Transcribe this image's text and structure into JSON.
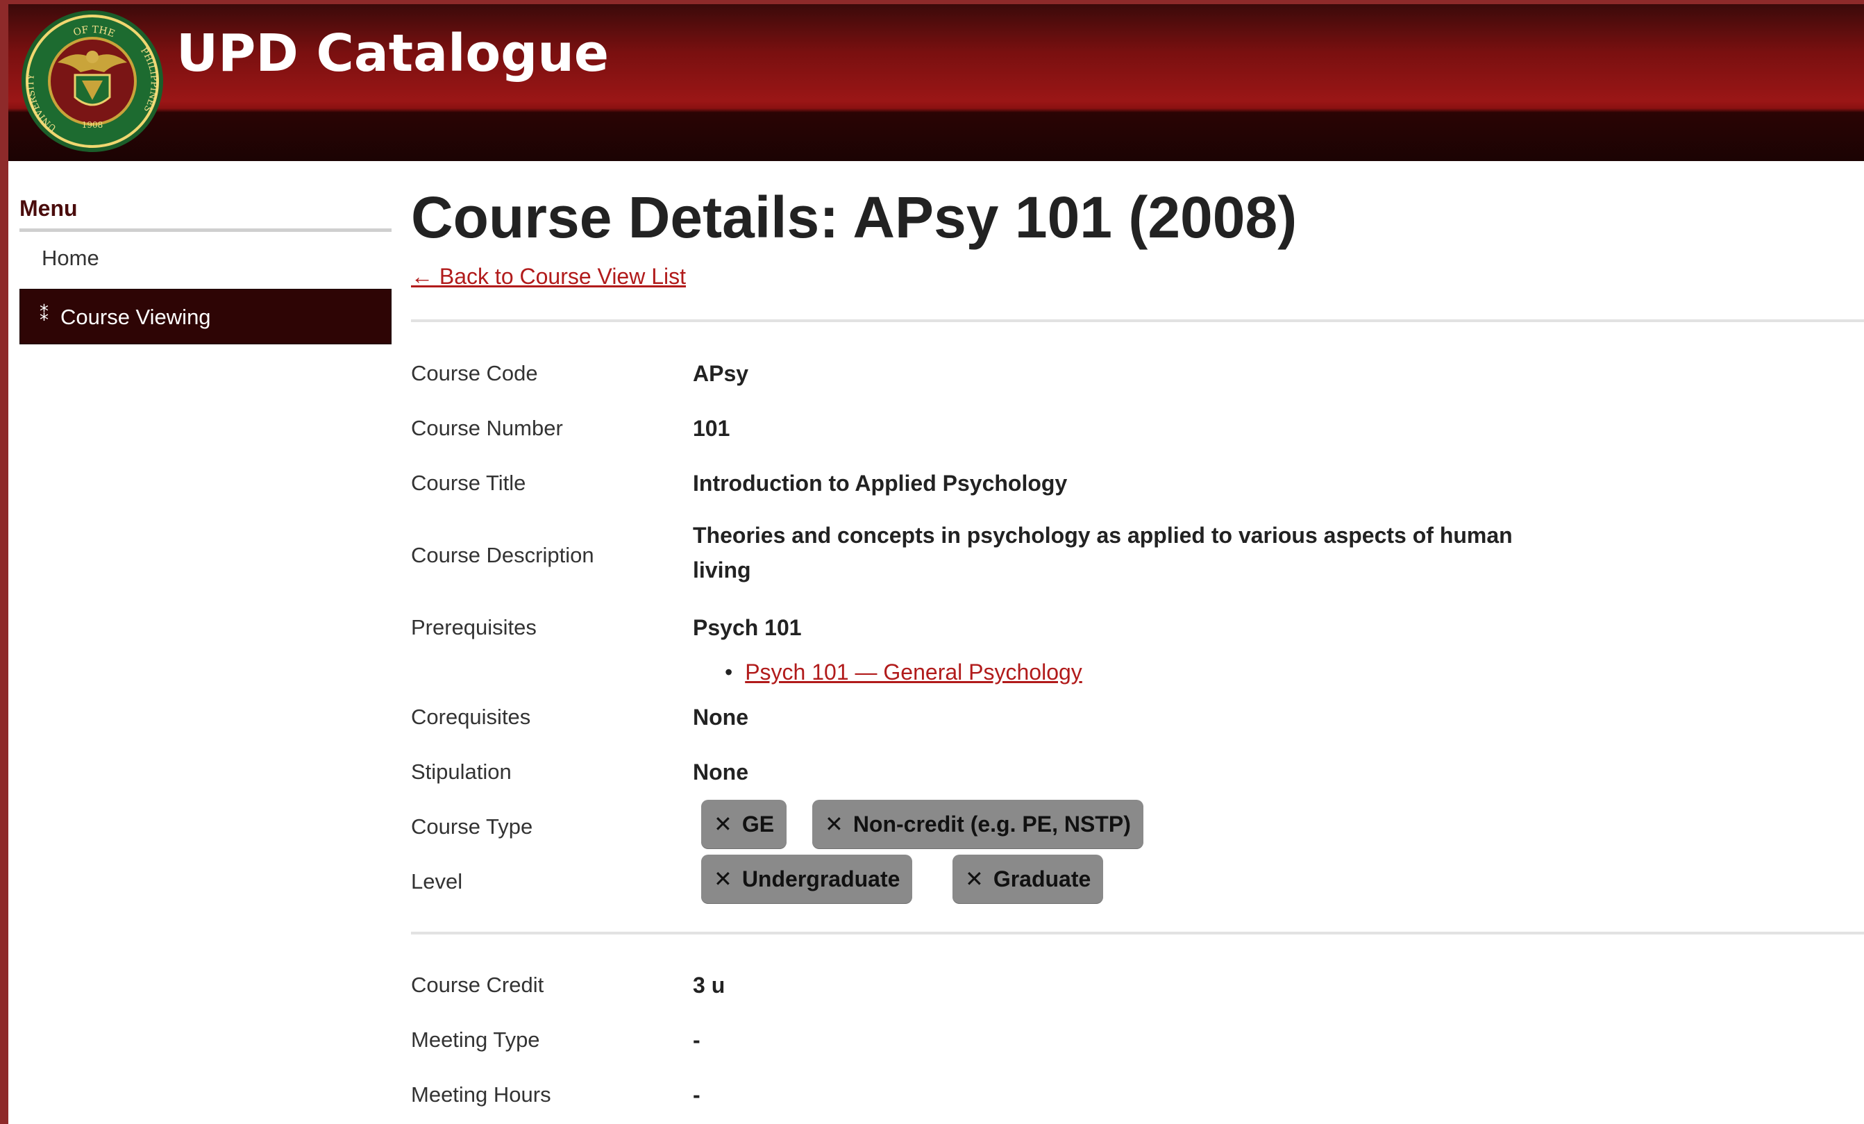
{
  "header": {
    "app_title": "UPD Catalogue",
    "seal": {
      "top_text": "OF THE",
      "left_text": "UNIVERSITY",
      "right_text": "PHILIPPINES",
      "year": "1908"
    }
  },
  "sidebar": {
    "heading": "Menu",
    "items": [
      {
        "label": "Home",
        "active": false
      },
      {
        "label": "Course Viewing",
        "active": true
      }
    ]
  },
  "main": {
    "title": "Course Details:  APsy 101 (2008)",
    "back_link": "← Back to Course View List",
    "fields": {
      "course_code": {
        "label": "Course Code",
        "value": "APsy"
      },
      "course_number": {
        "label": "Course Number",
        "value": "101"
      },
      "course_title": {
        "label": "Course Title",
        "value": "Introduction to Applied Psychology"
      },
      "course_description": {
        "label": "Course Description",
        "value": "Theories and concepts in psychology as applied to various aspects of human living"
      },
      "prerequisites": {
        "label": "Prerequisites",
        "value": "Psych 101",
        "links": [
          "Psych 101 — General Psychology"
        ]
      },
      "corequisites": {
        "label": "Corequisites",
        "value": "None"
      },
      "stipulation": {
        "label": "Stipulation",
        "value": "None"
      },
      "course_type": {
        "label": "Course Type",
        "chips": [
          "GE",
          "Non-credit (e.g. PE, NSTP)"
        ]
      },
      "level": {
        "label": "Level",
        "chips": [
          "Undergraduate",
          "Graduate"
        ]
      },
      "course_credit": {
        "label": "Course Credit",
        "value": "3 u"
      },
      "meeting_type": {
        "label": "Meeting Type",
        "value": "-"
      },
      "meeting_hours": {
        "label": "Meeting Hours",
        "value": "-"
      }
    }
  },
  "colors": {
    "brand_dark": "#2e0505",
    "brand_red": "#9b1616",
    "link": "#b11b1b",
    "chip_bg": "#8a8a8a",
    "outer_frame": "#8e2a2a"
  },
  "icons": {
    "seal": "university-seal-icon",
    "chevron": "double-chevron-icon",
    "remove": "x-icon"
  }
}
